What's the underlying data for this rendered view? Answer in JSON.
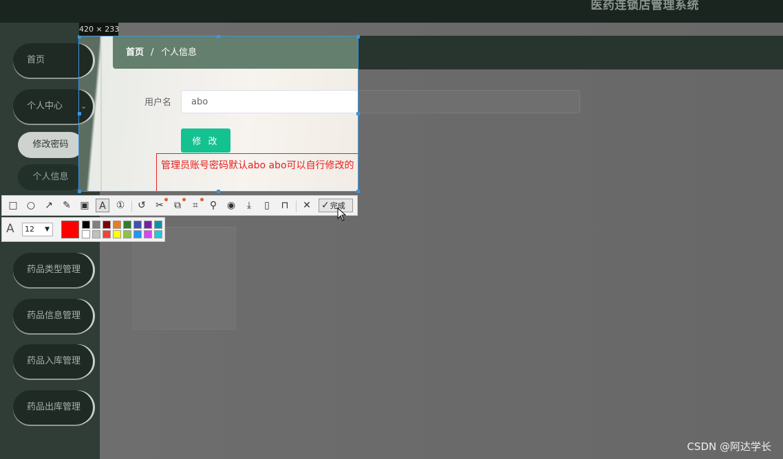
{
  "app": {
    "title": "医药连锁店管理系统"
  },
  "sidebar": {
    "items": [
      {
        "label": "首页"
      },
      {
        "label": "个人中心",
        "expanded_icon": "chevron-down-icon"
      },
      {
        "label": "药品类型管理"
      },
      {
        "label": "药品信息管理"
      },
      {
        "label": "药品入库管理"
      },
      {
        "label": "药品出库管理"
      }
    ],
    "sub_items": [
      {
        "label": "修改密码"
      },
      {
        "label": "个人信息"
      }
    ]
  },
  "breadcrumb": {
    "home": "首页",
    "separator": "/",
    "current": "个人信息"
  },
  "form": {
    "username_label": "用户名",
    "username_value": "abo",
    "submit_label": "修 改"
  },
  "capture": {
    "size_text": "420 × 233",
    "annotation_text": "管理员账号密码默认abo abo可以自行修改的",
    "annotation_color": "#e8201e",
    "selection_color": "#3b96e2"
  },
  "toolbar": {
    "tools": [
      "rectangle-icon",
      "ellipse-icon",
      "arrow-icon",
      "pencil-icon",
      "mosaic-icon",
      "text-icon",
      "number-icon",
      "undo-icon",
      "cut-icon",
      "ocr-icon",
      "translate-icon",
      "pin-icon",
      "record-icon",
      "download-icon",
      "save-icon",
      "bookmark-icon",
      "close-icon"
    ],
    "done_label": "完成"
  },
  "options": {
    "font_size": "12",
    "current_color": "#ff0000",
    "palette": [
      "#000000",
      "#808080",
      "#800000",
      "#e67e22",
      "#2e7d32",
      "#3f51b5",
      "#7b1fa2",
      "#0097a7",
      "#ffffff",
      "#c0c0c0",
      "#f44336",
      "#ffff00",
      "#8bc34a",
      "#2196f3",
      "#e040fb",
      "#26c6da"
    ]
  },
  "watermark": "CSDN @阿达学长"
}
